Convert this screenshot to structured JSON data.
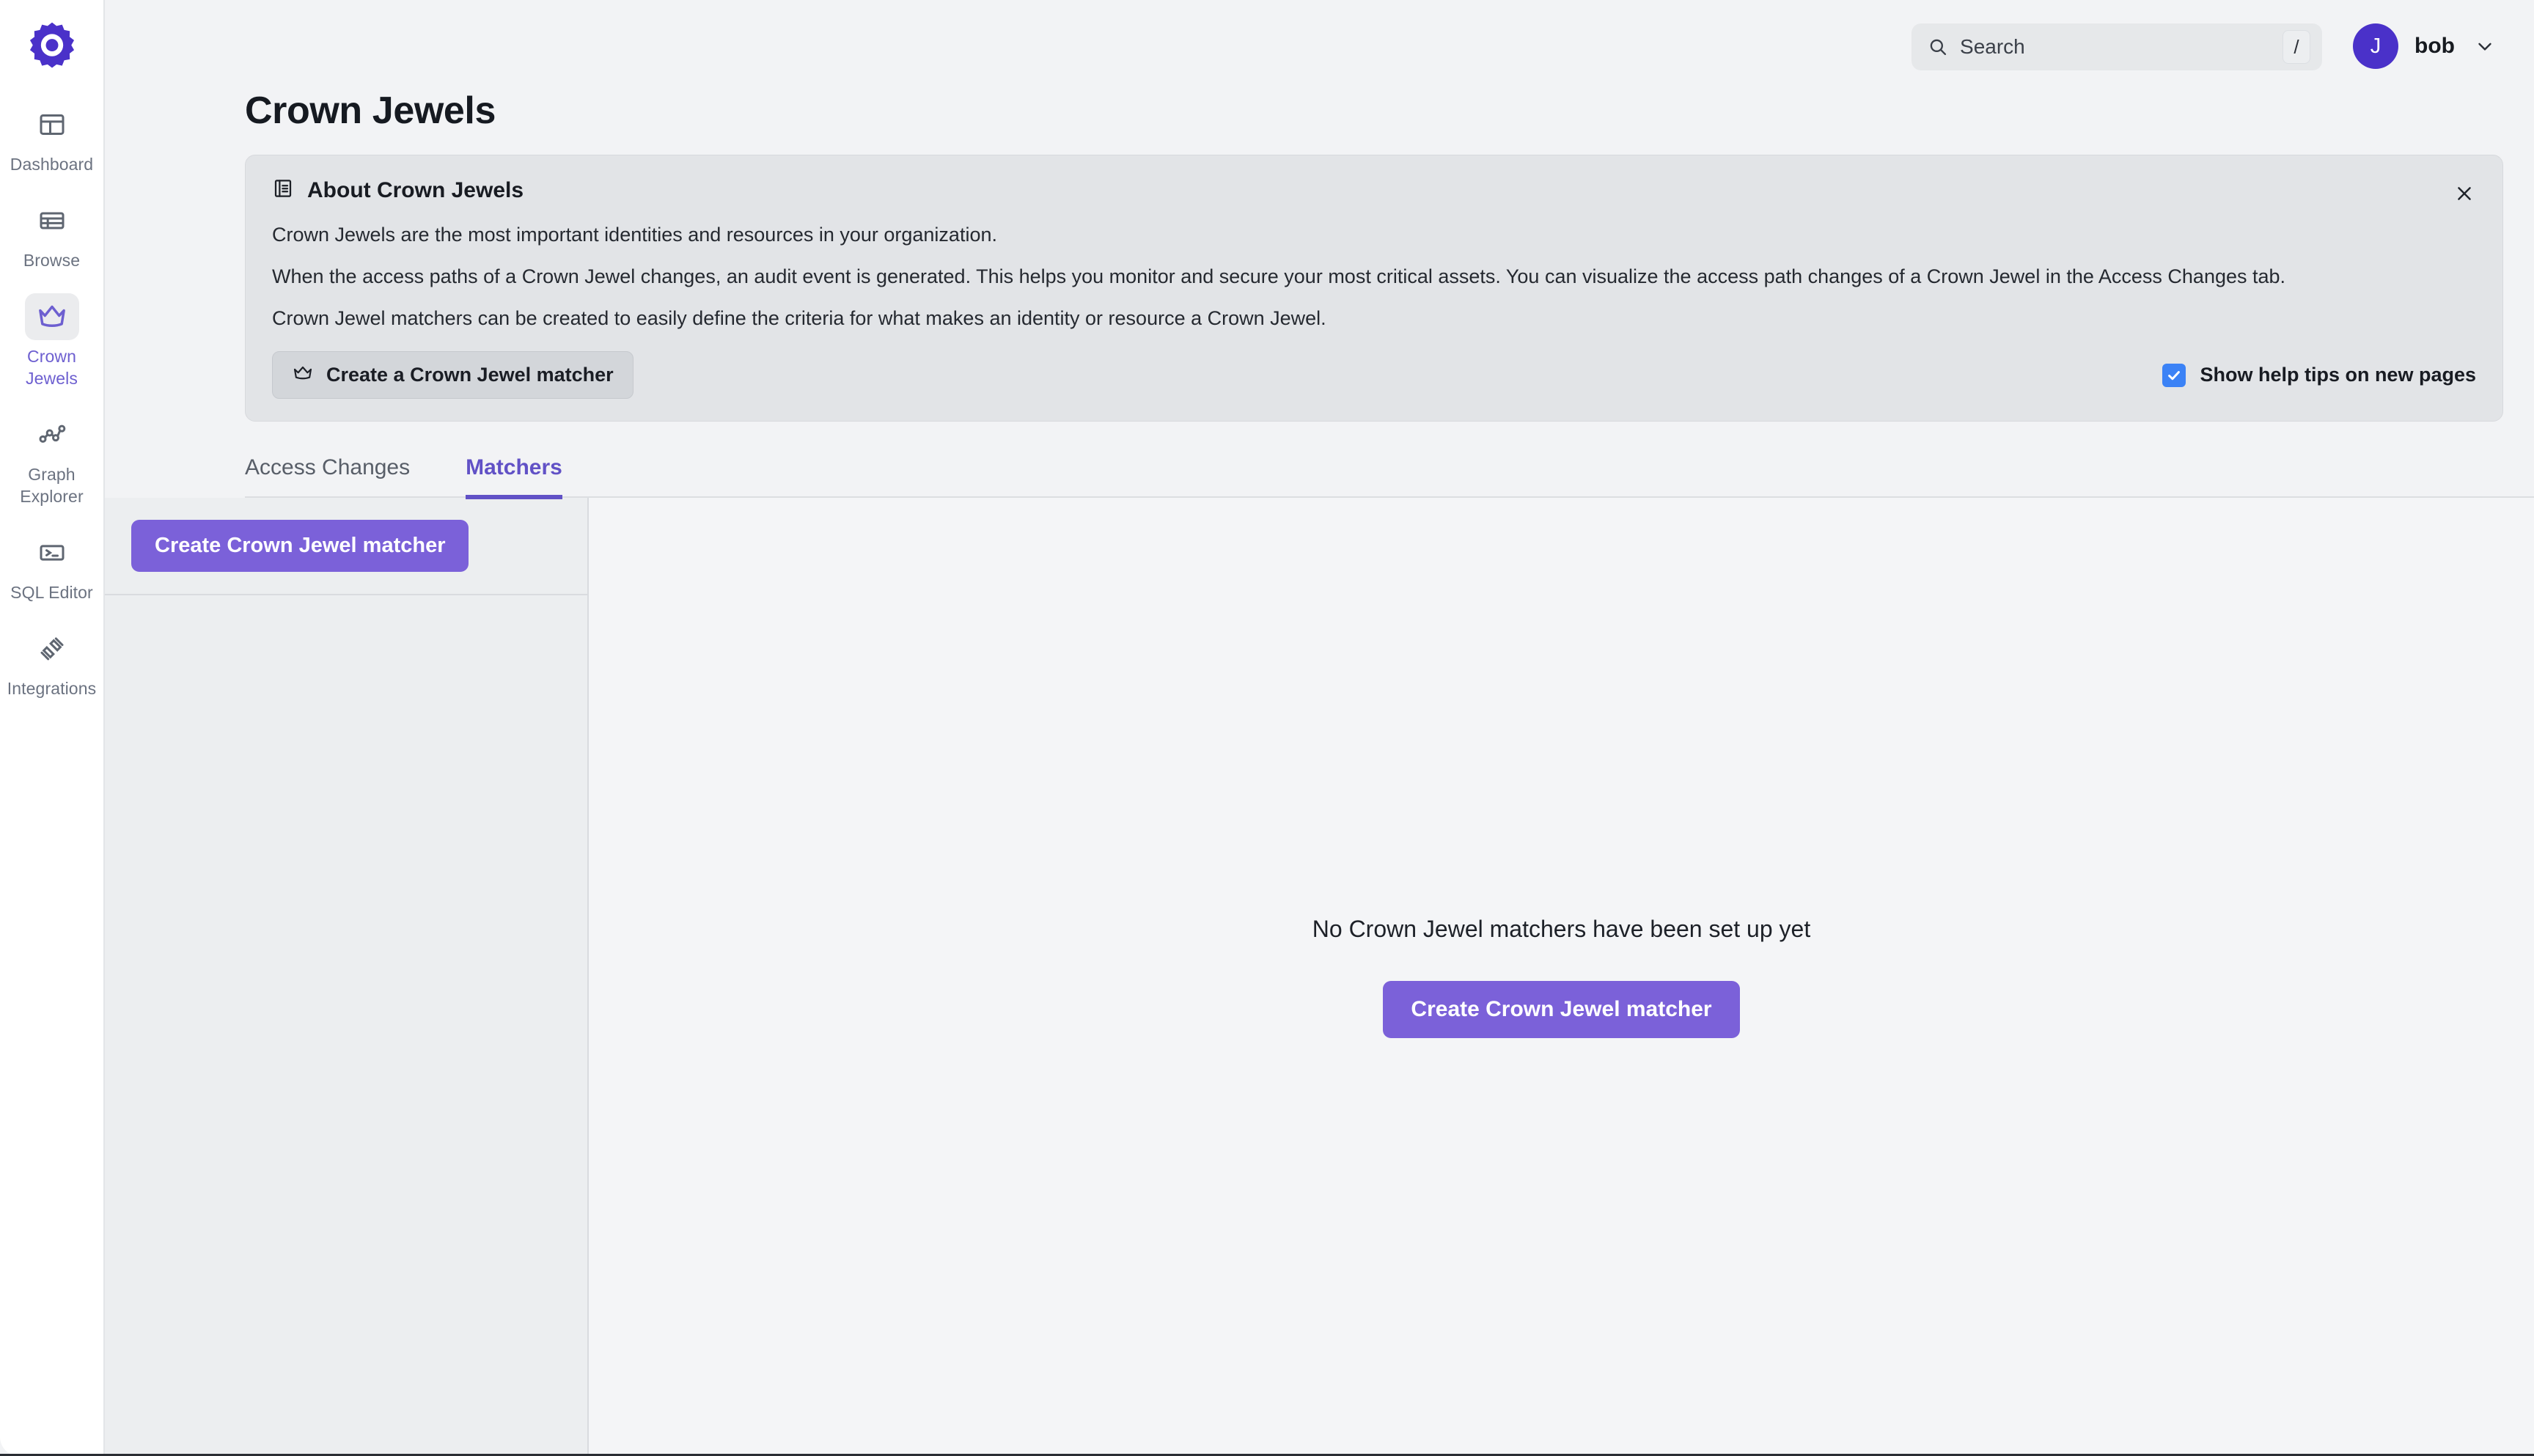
{
  "header": {
    "search": {
      "icon": "search-icon",
      "placeholder": "Search",
      "value": "",
      "shortcut": "/"
    },
    "user": {
      "avatar_initial": "J",
      "name": "bob",
      "caret_icon": "chevron-down-icon"
    }
  },
  "sidebar": {
    "logo_icon": "gear-logo-icon",
    "items": [
      {
        "label": "Dashboard",
        "icon": "dashboard-icon",
        "active": false
      },
      {
        "label": "Browse",
        "icon": "table-icon",
        "active": false
      },
      {
        "label": "Crown\nJewels",
        "icon": "crown-icon",
        "active": true
      },
      {
        "label": "Graph\nExplorer",
        "icon": "graph-nodes-icon",
        "active": false
      },
      {
        "label": "SQL Editor",
        "icon": "terminal-icon",
        "active": false
      },
      {
        "label": "Integrations",
        "icon": "plug-icon",
        "active": false
      }
    ]
  },
  "page": {
    "title": "Crown Jewels"
  },
  "about": {
    "icon": "book-icon",
    "title": "About Crown Jewels",
    "paragraphs": [
      "Crown Jewels are the most important identities and resources in your organization.",
      "When the access paths of a Crown Jewel changes, an audit event is generated. This helps you monitor and secure your most critical assets. You can visualize the access path changes of a Crown Jewel in the Access Changes tab.",
      "Crown Jewel matchers can be created to easily define the criteria for what makes an identity or resource a Crown Jewel."
    ],
    "cta_label": "Create a Crown Jewel matcher",
    "cta_icon": "crown-outline-icon",
    "help_tips": {
      "label": "Show help tips on new pages",
      "checked": true,
      "color": "#3b82f6"
    },
    "close_icon": "close-icon"
  },
  "tabs": [
    {
      "label": "Access Changes",
      "active": false
    },
    {
      "label": "Matchers",
      "active": true
    }
  ],
  "left_panel": {
    "create_button_label": "Create Crown Jewel matcher",
    "items": []
  },
  "empty_state": {
    "message": "No Crown Jewel matchers have been set up yet",
    "cta_label": "Create Crown Jewel matcher"
  },
  "colors": {
    "accent_purple": "#7b61d9",
    "tab_active": "#6151c6",
    "avatar": "#4a31c9",
    "checkbox_blue": "#3b82f6",
    "logo_purple": "#4a31c9"
  }
}
